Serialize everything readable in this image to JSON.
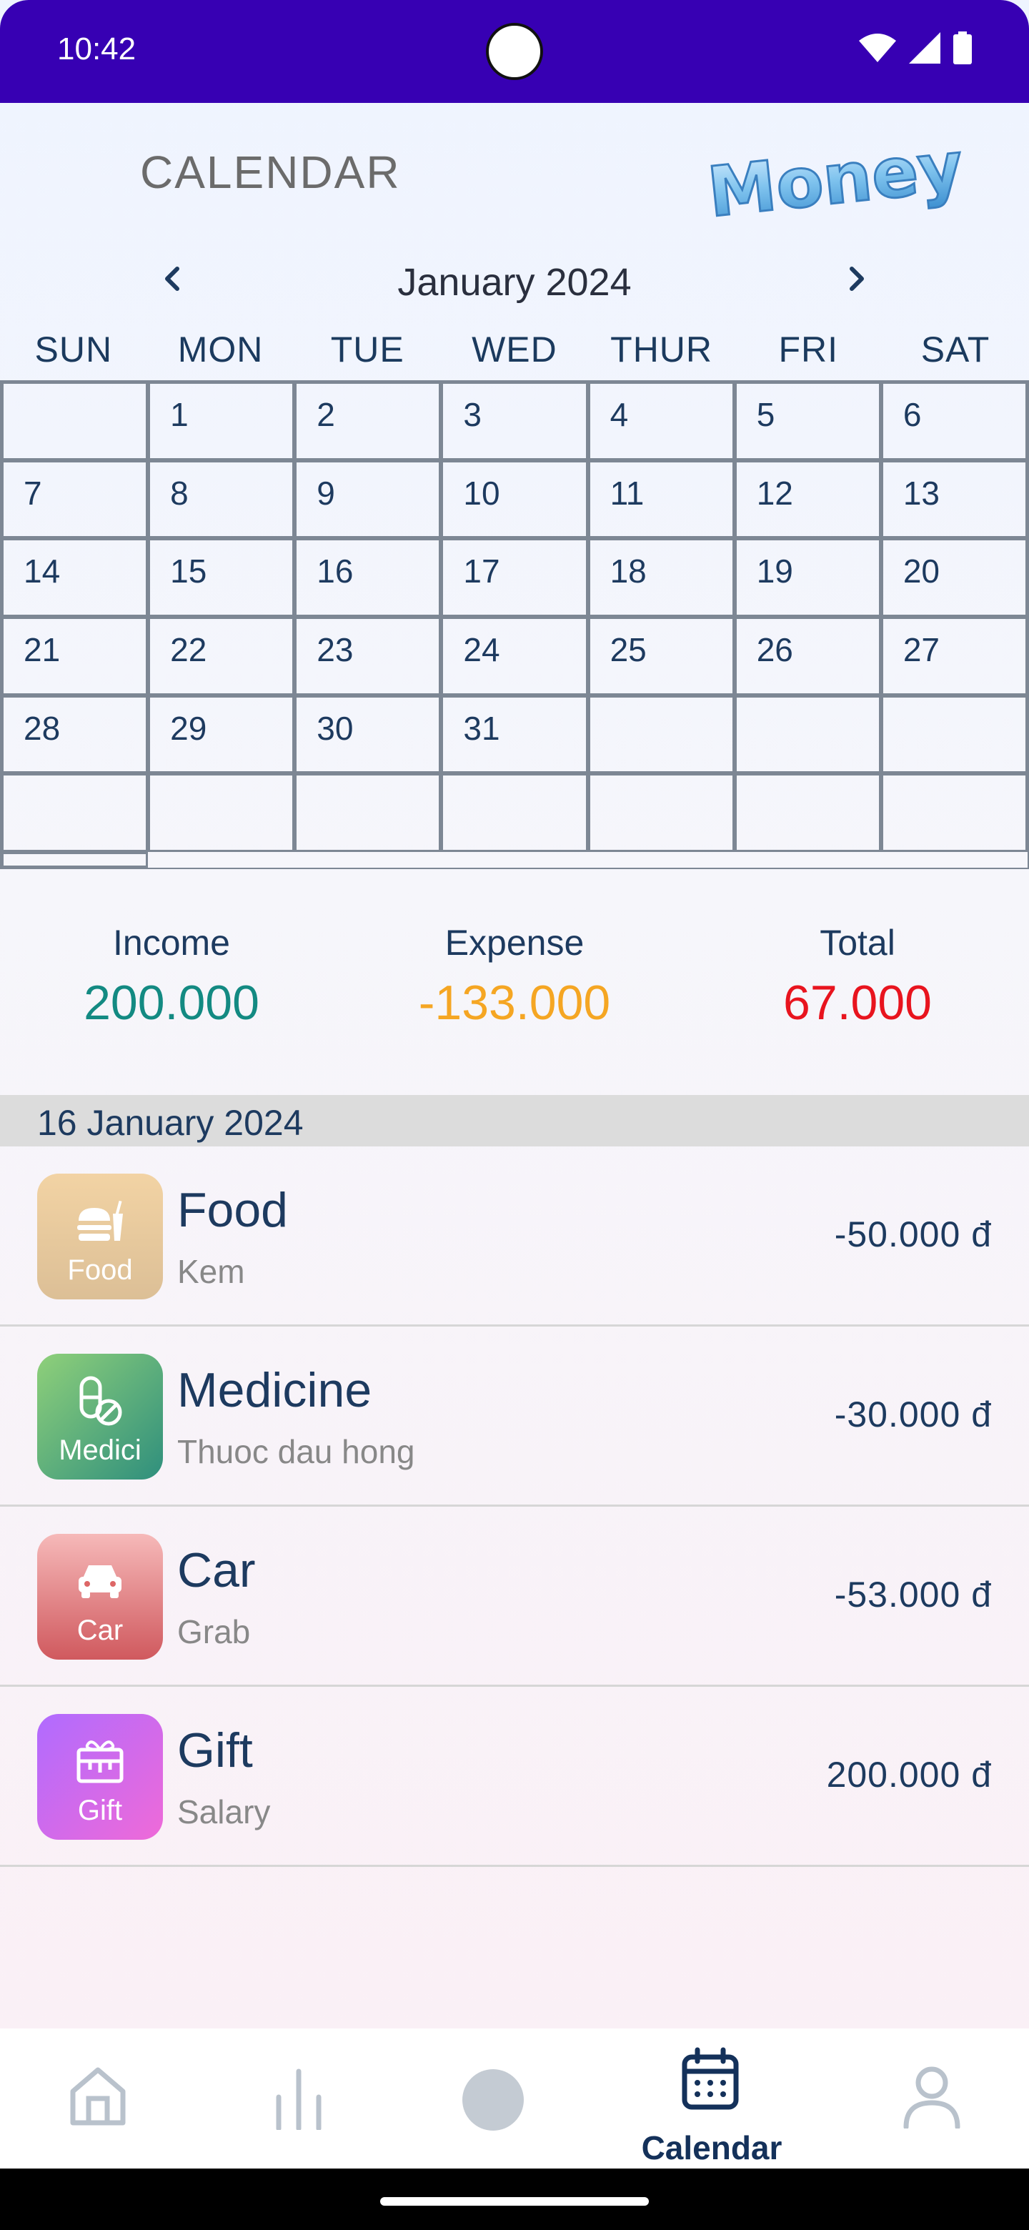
{
  "status_bar": {
    "time": "10:42"
  },
  "header": {
    "title": "CALENDAR",
    "logo_text": "Money"
  },
  "calendar": {
    "month_label": "January 2024",
    "weekdays": [
      "SUN",
      "MON",
      "TUE",
      "WED",
      "THUR",
      "FRI",
      "SAT"
    ],
    "cells": [
      "",
      "1",
      "2",
      "3",
      "4",
      "5",
      "6",
      "7",
      "8",
      "9",
      "10",
      "11",
      "12",
      "13",
      "14",
      "15",
      "16",
      "17",
      "18",
      "19",
      "20",
      "21",
      "22",
      "23",
      "24",
      "25",
      "26",
      "27",
      "28",
      "29",
      "30",
      "31",
      "",
      "",
      "",
      "",
      "",
      "",
      "",
      "",
      "",
      "",
      ""
    ]
  },
  "summary": {
    "income_label": "Income",
    "income_value": "200.000",
    "expense_label": "Expense",
    "expense_value": "-133.000",
    "total_label": "Total",
    "total_value": "67.000"
  },
  "selected_date": "16 January 2024",
  "transactions": [
    {
      "category": "Food",
      "icon_label": "Food",
      "note": "Kem",
      "amount": "-50.000 đ",
      "icon": "burger-icon"
    },
    {
      "category": "Medicine",
      "icon_label": "Medici",
      "note": "Thuoc dau hong",
      "amount": "-30.000 đ",
      "icon": "pill-icon"
    },
    {
      "category": "Car",
      "icon_label": "Car",
      "note": "Grab",
      "amount": "-53.000 đ",
      "icon": "car-icon"
    },
    {
      "category": "Gift",
      "icon_label": "Gift",
      "note": "Salary",
      "amount": "200.000 đ",
      "icon": "gift-icon"
    }
  ],
  "bottom_nav": {
    "active_label": "Calendar"
  },
  "colors": {
    "income": "#138a82",
    "expense": "#f5a623",
    "total": "#e8141e",
    "status_bar": "#3700b3",
    "text_primary": "#1d3a5f"
  }
}
